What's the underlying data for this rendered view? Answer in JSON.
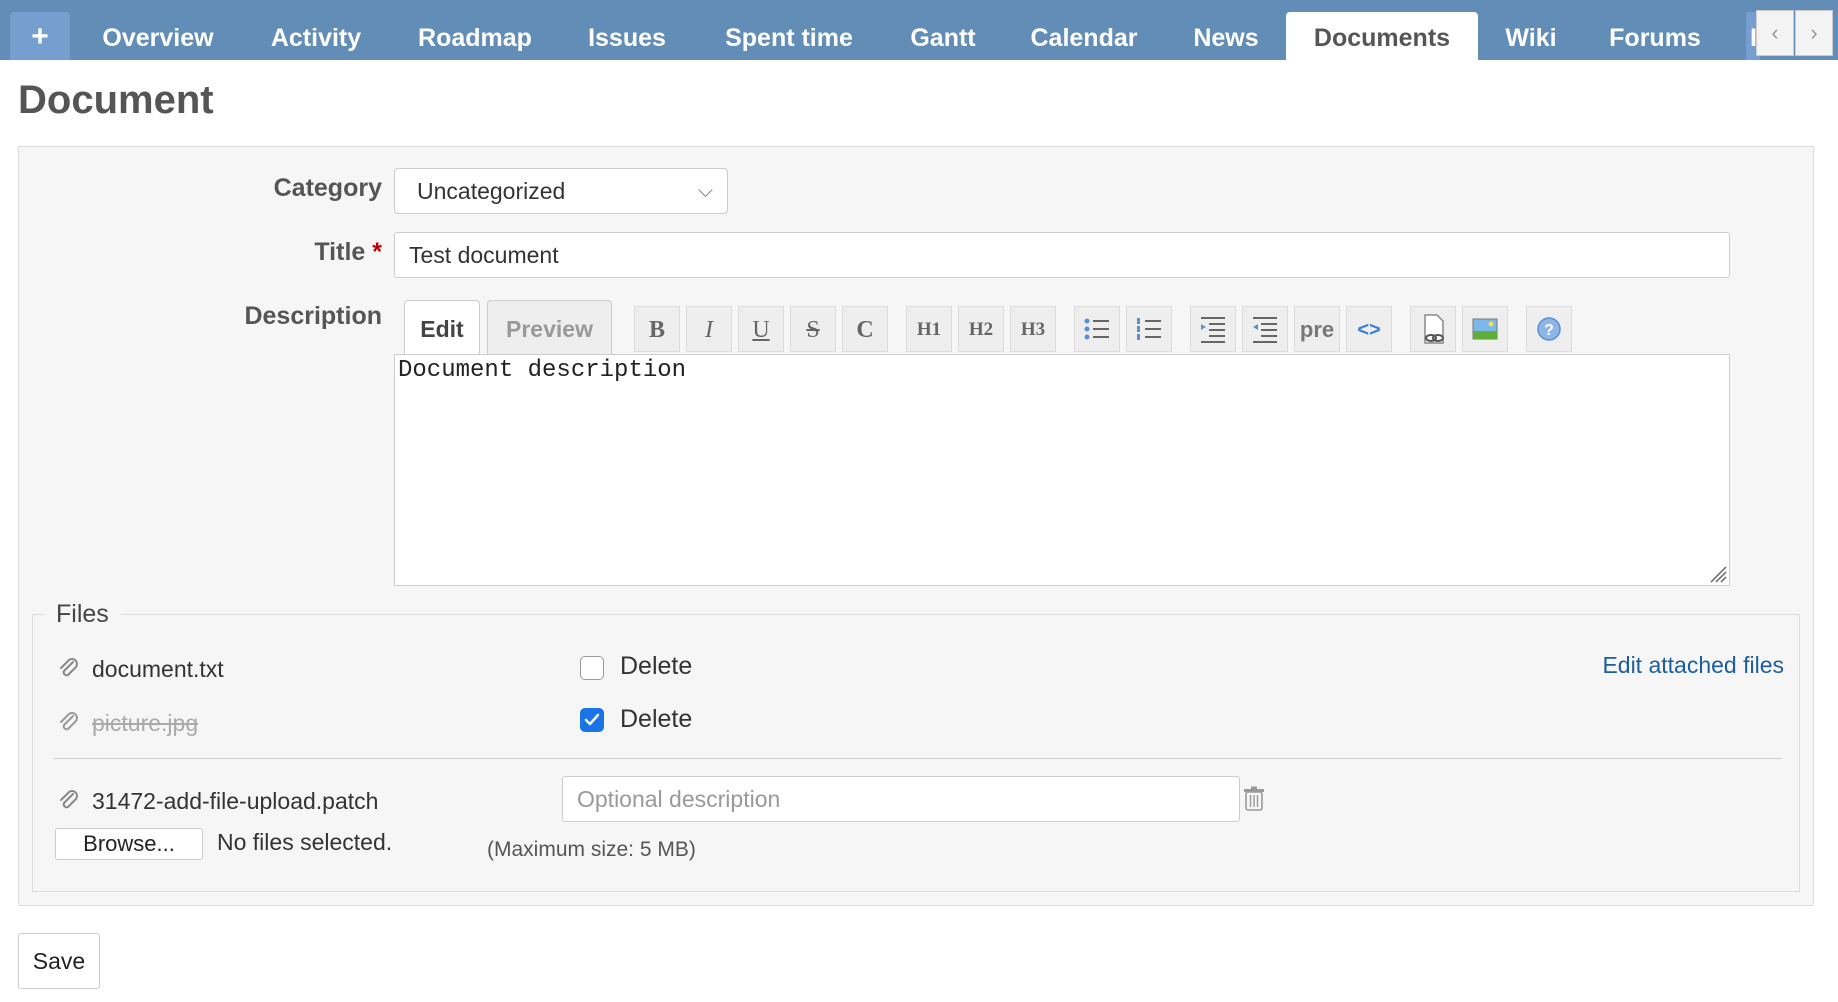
{
  "tabs": {
    "new_label": "+",
    "items": [
      {
        "label": "Overview"
      },
      {
        "label": "Activity"
      },
      {
        "label": "Roadmap"
      },
      {
        "label": "Issues"
      },
      {
        "label": "Spent time"
      },
      {
        "label": "Gantt"
      },
      {
        "label": "Calendar"
      },
      {
        "label": "News"
      },
      {
        "label": "Documents",
        "selected": true
      },
      {
        "label": "Wiki"
      },
      {
        "label": "Forums"
      }
    ],
    "overflow_label": "I",
    "scroll_left_icon": "chevron-left-icon",
    "scroll_right_icon": "chevron-right-icon"
  },
  "page": {
    "title": "Document"
  },
  "form": {
    "category": {
      "label": "Category",
      "value": "Uncategorized"
    },
    "title": {
      "label": "Title",
      "required_mark": "*",
      "value": "Test document"
    },
    "description": {
      "label": "Description",
      "edit_tab": "Edit",
      "preview_tab": "Preview",
      "value": "Document description",
      "toolbar": [
        {
          "name": "bold-button",
          "glyph": "B"
        },
        {
          "name": "italic-button",
          "glyph": "I"
        },
        {
          "name": "underline-button",
          "glyph": "U"
        },
        {
          "name": "strikethrough-button",
          "glyph": "S"
        },
        {
          "name": "code-button",
          "glyph": "C"
        },
        {
          "name": "heading1-button",
          "glyph": "H1"
        },
        {
          "name": "heading2-button",
          "glyph": "H2"
        },
        {
          "name": "heading3-button",
          "glyph": "H3"
        },
        {
          "name": "unordered-list-button",
          "glyph": ""
        },
        {
          "name": "ordered-list-button",
          "glyph": ""
        },
        {
          "name": "blockquote-button",
          "glyph": ""
        },
        {
          "name": "unquote-button",
          "glyph": ""
        },
        {
          "name": "preformatted-button",
          "glyph": "pre"
        },
        {
          "name": "highlighted-code-button",
          "glyph": "<>"
        },
        {
          "name": "wiki-link-button",
          "glyph": ""
        },
        {
          "name": "image-button",
          "glyph": ""
        },
        {
          "name": "help-button",
          "glyph": "?"
        }
      ]
    }
  },
  "files": {
    "legend": "Files",
    "edit_attached_link": "Edit attached files",
    "attached": [
      {
        "name": "document.txt",
        "delete_label": "Delete",
        "delete_checked": false
      },
      {
        "name": "picture.jpg",
        "delete_label": "Delete",
        "delete_checked": true
      }
    ],
    "new_upload": {
      "name": "31472-add-file-upload.patch",
      "description_placeholder": "Optional description"
    },
    "browse_label": "Browse...",
    "no_files_text": "No files selected.",
    "max_size_text": "(Maximum size: 5 MB)"
  },
  "actions": {
    "save_label": "Save"
  },
  "colors": {
    "tabbar": "#628db6",
    "link": "#1d5d9d",
    "required": "#bb0000",
    "checkbox_checked": "#1b73e8"
  }
}
